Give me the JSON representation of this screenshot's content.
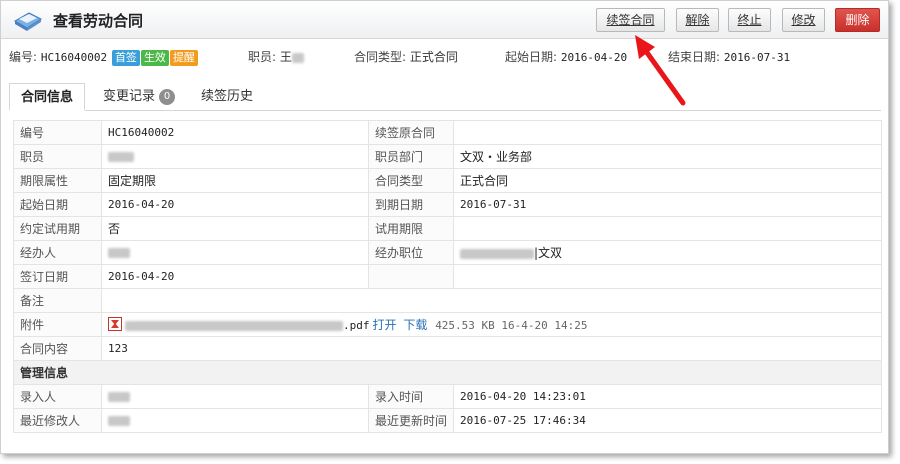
{
  "header": {
    "title": "查看劳动合同",
    "buttons": {
      "renew": "续签合同",
      "terminate": "解除",
      "stop": "终止",
      "edit": "修改",
      "delete": "删除"
    }
  },
  "info": {
    "code_label": "编号:",
    "code_value": "HC16040002",
    "badges": [
      "首签",
      "生效",
      "提醒"
    ],
    "employee_label": "职员:",
    "employee_value": "王",
    "type_label": "合同类型:",
    "type_value": "正式合同",
    "start_label": "起始日期:",
    "start_value": "2016-04-20",
    "end_label": "结束日期:",
    "end_value": "2016-07-31"
  },
  "tabs": [
    {
      "label": "合同信息"
    },
    {
      "label": "变更记录",
      "count": "0"
    },
    {
      "label": "续签历史"
    }
  ],
  "details": {
    "code_label": "编号",
    "code_value": "HC16040002",
    "renew_orig_label": "续签原合同",
    "renew_orig_value": "",
    "employee_label": "职员",
    "dept_label": "职员部门",
    "dept_value": "文双・业务部",
    "term_label": "期限属性",
    "term_value": "固定期限",
    "type_label": "合同类型",
    "type_value": "正式合同",
    "start_label": "起始日期",
    "start_value": "2016-04-20",
    "expire_label": "到期日期",
    "expire_value": "2016-07-31",
    "probation_label": "约定试用期",
    "probation_value": "否",
    "probation_period_label": "试用期限",
    "probation_period_value": "",
    "handler_label": "经办人",
    "handler_pos_label": "经办职位",
    "handler_pos_value": "|文双",
    "sign_label": "签订日期",
    "sign_value": "2016-04-20",
    "remark_label": "备注",
    "remark_value": "",
    "attach_label": "附件",
    "attach_ext": ".pdf",
    "attach_open": "打开",
    "attach_download": "下载",
    "attach_meta": "425.53 KB 16-4-20 14:25",
    "content_label": "合同内容",
    "content_value": "123"
  },
  "management": {
    "section_title": "管理信息",
    "entered_by_label": "录入人",
    "entered_time_label": "录入时间",
    "entered_time_value": "2016-04-20 14:23:01",
    "modified_by_label": "最近修改人",
    "updated_time_label": "最近更新时间",
    "updated_time_value": "2016-07-25 17:46:34"
  },
  "colors": {
    "accent_blue": "#3a9fd8",
    "accent_green": "#4cb848",
    "accent_orange": "#f29c1f",
    "danger_red": "#c9302c",
    "arrow_red": "#e8151b"
  }
}
